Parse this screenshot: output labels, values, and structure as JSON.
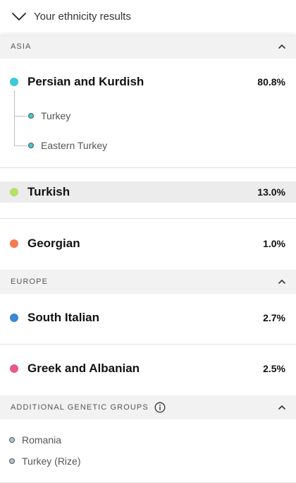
{
  "header": {
    "title": "Your ethnicity results",
    "chevron_icon": "chevron-down-icon"
  },
  "sections": [
    {
      "label": "ASIA",
      "collapse_icon": "chevron-up-icon",
      "regions": [
        {
          "name": "Persian and Kurdish",
          "percent": "80.8%",
          "color": "#3dc9d8",
          "subregions": [
            "Turkey",
            "Eastern Turkey"
          ]
        },
        {
          "name": "Turkish",
          "percent": "13.0%",
          "color": "#b5e06a",
          "highlighted": true
        },
        {
          "name": "Georgian",
          "percent": "1.0%",
          "color": "#f47b4f"
        }
      ]
    },
    {
      "label": "EUROPE",
      "collapse_icon": "chevron-up-icon",
      "regions": [
        {
          "name": "South Italian",
          "percent": "2.7%",
          "color": "#3b86d6"
        },
        {
          "name": "Greek and Albanian",
          "percent": "2.5%",
          "color": "#e8588e"
        }
      ]
    },
    {
      "label": "ADDITIONAL GENETIC GROUPS",
      "info_icon": "info-icon",
      "collapse_icon": "chevron-up-icon",
      "groups": [
        "Romania",
        "Turkey (Rize)"
      ],
      "group_dot_color": "#a9c3de"
    }
  ]
}
